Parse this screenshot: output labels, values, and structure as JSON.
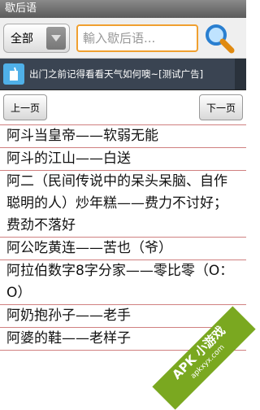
{
  "app": {
    "title": "歇后语"
  },
  "search": {
    "category": "全部",
    "placeholder": "輸入歇后语..."
  },
  "ad": {
    "text": "出门之前记得看看天气如何噢~[测试广告]"
  },
  "pager": {
    "prev": "上一页",
    "next": "下一页"
  },
  "items": [
    "阿斗当皇帝——软弱无能",
    "阿斗的江山——白送",
    "阿二（民间传说中的呆头呆脑、自作聪明的人）炒年糕——费力不讨好；费劲不落好",
    "阿公吃黄连——苦也（爷）",
    "阿拉伯数字8字分家——零比零（O：O）",
    "阿奶抱孙子——老手",
    "阿婆的鞋——老样子"
  ],
  "watermark": {
    "brand": "APK 小游戏",
    "url": "apkxyx.com"
  }
}
